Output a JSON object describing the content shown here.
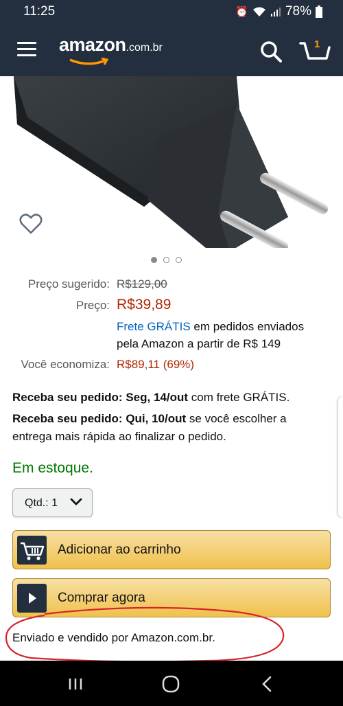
{
  "status_bar": {
    "time": "11:25",
    "battery": "78%"
  },
  "header": {
    "logo_word": "amazon",
    "logo_tld": ".com.br",
    "cart_count": "1"
  },
  "carousel": {
    "total": 3,
    "active": 1
  },
  "pricing": {
    "suggested_label": "Preço sugerido:",
    "suggested_value": "R$129,00",
    "price_label": "Preço:",
    "price_value": "R$39,89",
    "shipping_link": "Frete GRÁTIS",
    "shipping_rest": " em pedidos enviados",
    "shipping_line2": "pela Amazon a partir de R$ 149",
    "savings_label": "Você economiza:",
    "savings_value": "R$89,11 (69%)"
  },
  "delivery": {
    "line1_bold": "Receba seu pedido: Seg, 14/out",
    "line1_rest": " com frete GRÁTIS.",
    "line2_bold": "Receba seu pedido: Qui, 10/out",
    "line2_rest": " se você escolher a entrega mais rápida ao finalizar o pedido."
  },
  "stock_status": "Em estoque.",
  "quantity": {
    "label": "Qtd.: 1"
  },
  "buttons": {
    "add_to_cart": "Adicionar ao carrinho",
    "buy_now": "Comprar agora"
  },
  "seller_text": "Enviado e vendido por Amazon.com.br.",
  "colors": {
    "header_bg": "#232f3e",
    "price_red": "#b12704",
    "link_blue": "#0066c0",
    "stock_green": "#007600",
    "button_yellow": "#f0c14b"
  }
}
